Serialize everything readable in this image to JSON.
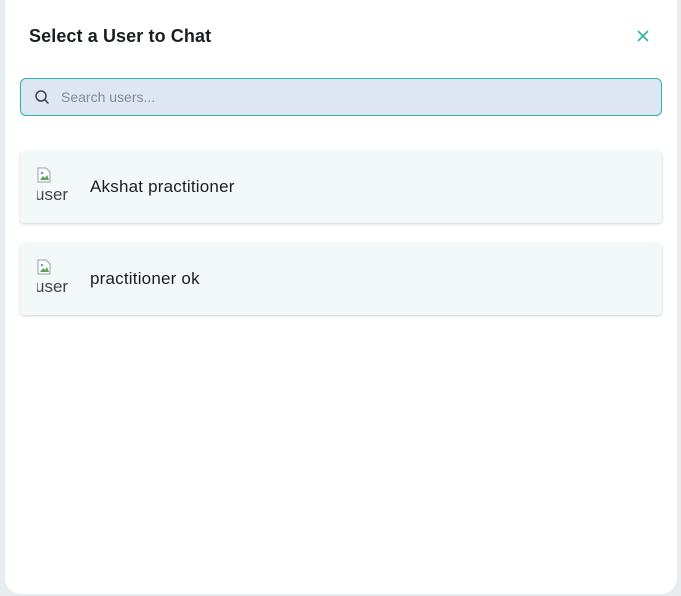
{
  "modal": {
    "title": "Select a User to Chat",
    "close_icon": "close-icon"
  },
  "search": {
    "placeholder": "Search users...",
    "value": "",
    "icon": "search-icon"
  },
  "users": [
    {
      "name": "Akshat practitioner",
      "avatar_alt": "user",
      "avatar_icon": "broken-image-icon"
    },
    {
      "name": "practitioner ok",
      "avatar_alt": "user",
      "avatar_icon": "broken-image-icon"
    }
  ],
  "colors": {
    "accent": "#2bb3a3",
    "search_bg": "#dfe6f3",
    "item_bg": "#f3f9f9",
    "title": "#1a1d21"
  }
}
